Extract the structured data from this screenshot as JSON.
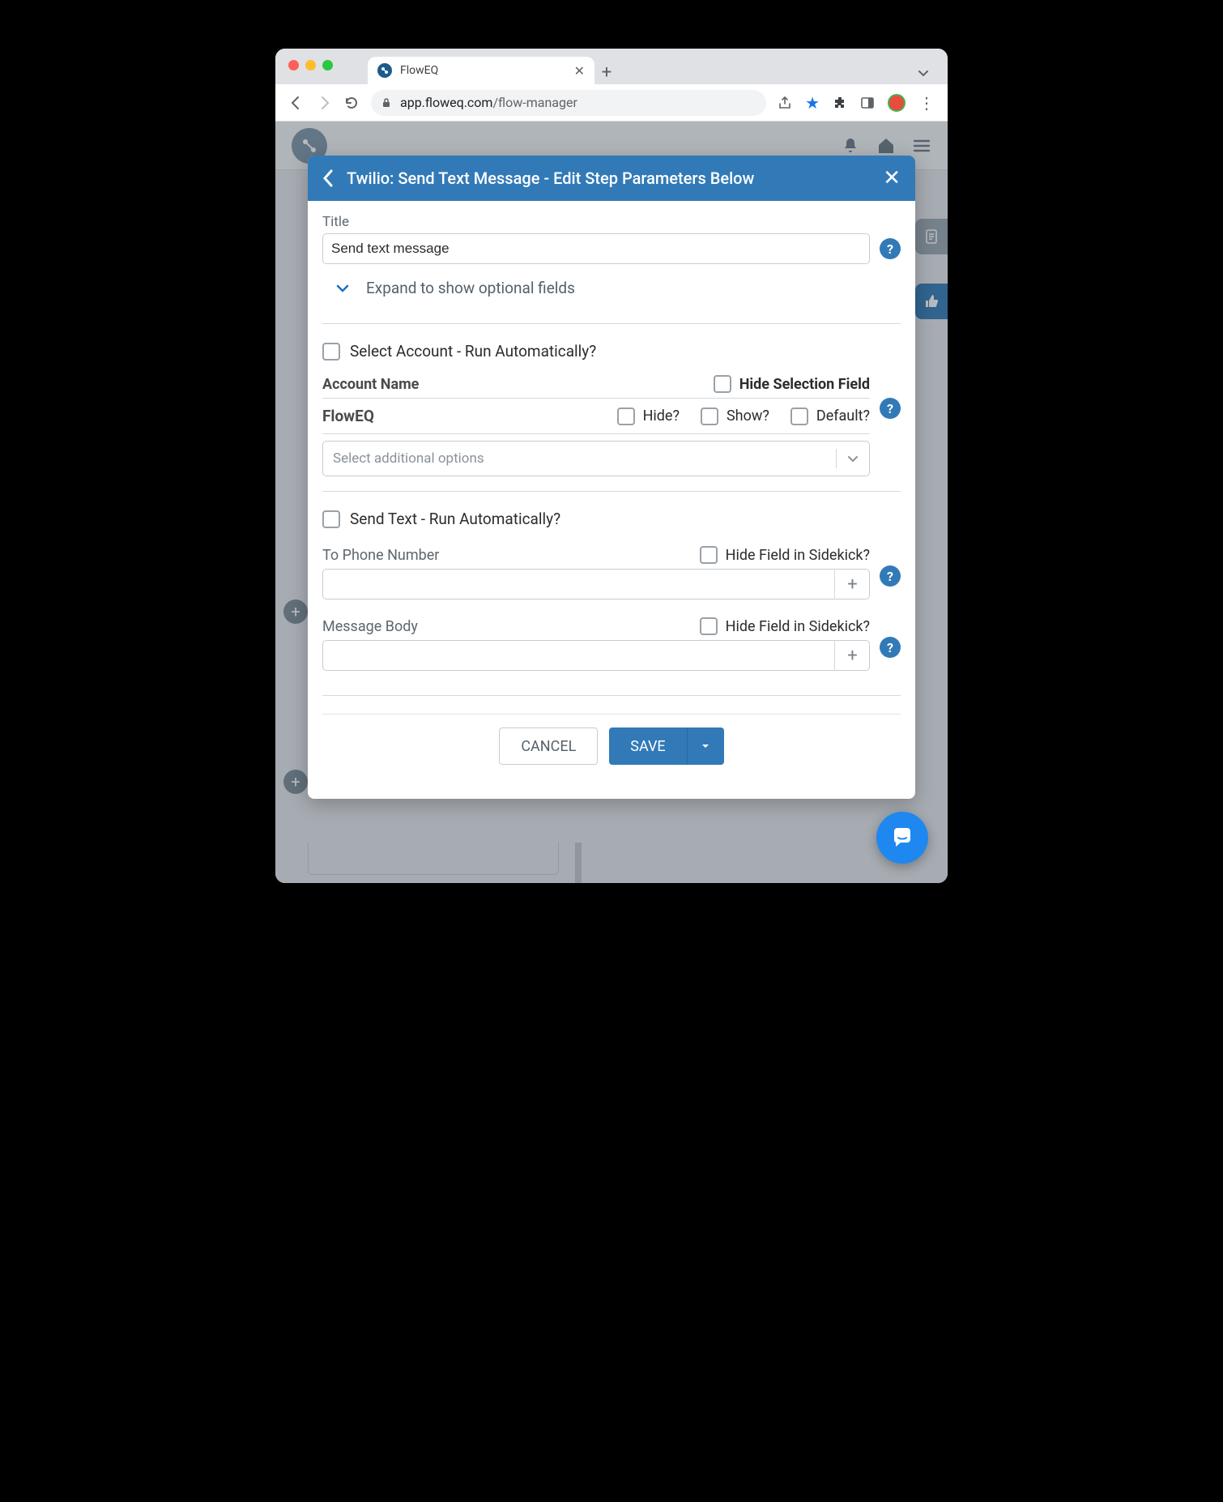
{
  "browser": {
    "tab_title": "FlowEQ",
    "url_domain": "app.floweq.com",
    "url_path": "/flow-manager"
  },
  "modal": {
    "header": "Twilio: Send Text Message - Edit Step Parameters Below",
    "title_label": "Title",
    "title_value": "Send text message",
    "expand_label": "Expand to show optional fields",
    "section1": {
      "run_auto": "Select Account - Run Automatically?",
      "col_account": "Account Name",
      "hide_selection": "Hide Selection Field",
      "row_name": "FlowEQ",
      "hide": "Hide?",
      "show": "Show?",
      "default": "Default?",
      "select_placeholder": "Select additional options"
    },
    "section2": {
      "run_auto": "Send Text - Run Automatically?",
      "phone_label": "To Phone Number",
      "msg_label": "Message Body",
      "hide_field": "Hide Field in Sidekick?"
    },
    "buttons": {
      "cancel": "CANCEL",
      "save": "SAVE"
    }
  }
}
